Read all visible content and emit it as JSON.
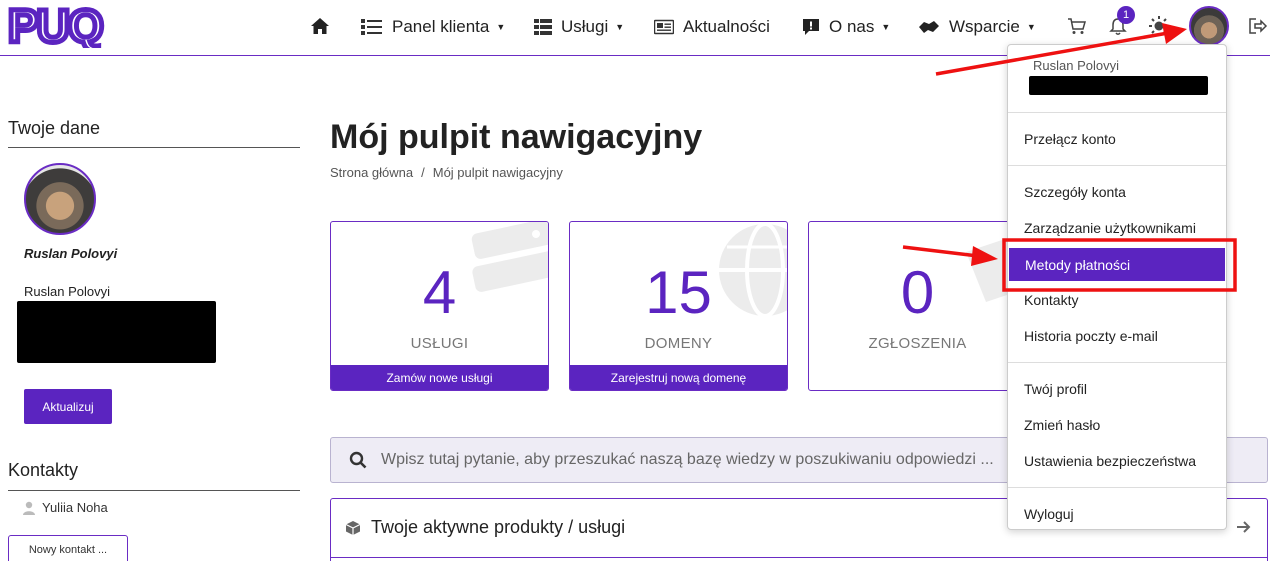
{
  "brand": {
    "logo_text": "PUQ",
    "accent_color": "#5b24c0"
  },
  "navbar": {
    "home_icon": "home-icon",
    "items": [
      {
        "label": "Panel klienta",
        "icon": "client-panel-icon",
        "has_caret": true
      },
      {
        "label": "Usługi",
        "icon": "services-list-icon",
        "has_caret": true
      },
      {
        "label": "Aktualności",
        "icon": "news-icon",
        "has_caret": false
      },
      {
        "label": "O nas",
        "icon": "about-icon",
        "has_caret": true
      },
      {
        "label": "Wsparcie",
        "icon": "support-icon",
        "has_caret": true
      }
    ],
    "cart_icon": "cart-icon",
    "notifications": {
      "icon": "bell-icon",
      "count": "1"
    },
    "theme_icon": "sun-icon",
    "logout_icon": "logout-icon"
  },
  "sidebar": {
    "your_data_heading": "Twoje dane",
    "full_name_italic": "Ruslan Polovyi",
    "name": "Ruslan Polovyi",
    "update_button": "Aktualizuj",
    "contacts_heading": "Kontakty",
    "contacts": [
      {
        "name": "Yuliia Noha"
      }
    ],
    "new_contact_button": "Nowy kontakt ..."
  },
  "main": {
    "title": "Mój pulpit nawigacyjny",
    "breadcrumb": {
      "home": "Strona główna",
      "separator": "/",
      "current": "Mój pulpit nawigacyjny"
    },
    "stats": [
      {
        "value": "4",
        "label": "USŁUGI",
        "footer": "Zamów nowe usługi"
      },
      {
        "value": "15",
        "label": "DOMENY",
        "footer": "Zarejestruj nową domenę"
      },
      {
        "value": "0",
        "label": "ZGŁOSZENIA",
        "footer": ""
      }
    ],
    "search": {
      "placeholder": "Wpisz tutaj pytanie, aby przeszukać naszą bazę wiedzy w poszukiwaniu odpowiedzi ..."
    },
    "products": {
      "title": "Twoje aktywne produkty / usługi"
    }
  },
  "dropdown": {
    "user_name": "Ruslan Polovyi",
    "items": [
      "Przełącz konto",
      "Szczegóły konta",
      "Zarządzanie użytkownikami",
      "Metody płatności",
      "Kontakty",
      "Historia poczty e-mail",
      "Twój profil",
      "Zmień hasło",
      "Ustawienia bezpieczeństwa",
      "Wyloguj"
    ],
    "active_item": "Metody płatności"
  },
  "annotation_color": "#ee1111"
}
